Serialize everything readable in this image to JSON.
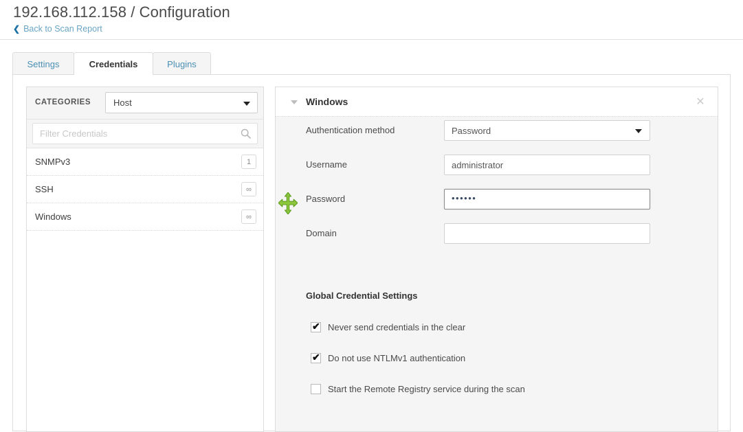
{
  "header": {
    "title": "192.168.112.158 / Configuration",
    "back_link": "Back to Scan Report",
    "back_chevron": "chevron-left-icon"
  },
  "tabs": [
    {
      "label": "Settings",
      "active": false
    },
    {
      "label": "Credentials",
      "active": true
    },
    {
      "label": "Plugins",
      "active": false
    }
  ],
  "sidebar": {
    "categories_label": "CATEGORIES",
    "category_select": {
      "value": "Host",
      "caret": "chevron-down-icon"
    },
    "filter": {
      "placeholder": "Filter Credentials",
      "value": "",
      "icon": "search-icon"
    },
    "items": [
      {
        "name": "SNMPv3",
        "badge": "1"
      },
      {
        "name": "SSH",
        "badge": "∞"
      },
      {
        "name": "Windows",
        "badge": "∞"
      }
    ]
  },
  "panel": {
    "title": "Windows",
    "collapse_icon": "triangle-down-icon",
    "close_icon": "close-icon",
    "fields": [
      {
        "label": "Authentication method",
        "type": "select",
        "value": "Password"
      },
      {
        "label": "Username",
        "type": "text",
        "value": "administrator"
      },
      {
        "label": "Password",
        "type": "password",
        "value": "••••••",
        "focused": true
      },
      {
        "label": "Domain",
        "type": "text",
        "value": ""
      }
    ],
    "global_settings_heading": "Global Credential Settings",
    "checkboxes": [
      {
        "label": "Never send credentials in the clear",
        "checked": true,
        "mark": "✔"
      },
      {
        "label": "Do not use NTLMv1 authentication",
        "checked": true,
        "mark": "✔"
      },
      {
        "label": "Start the Remote Registry service during the scan",
        "checked": false,
        "mark": ""
      }
    ]
  },
  "cursor": {
    "type": "move-cursor",
    "color": "#7ac143"
  },
  "colors": {
    "link": "#4a90b8",
    "tab_active_text": "#333333",
    "panel_bg": "#f5f5f5",
    "border": "#dcdcdc"
  }
}
